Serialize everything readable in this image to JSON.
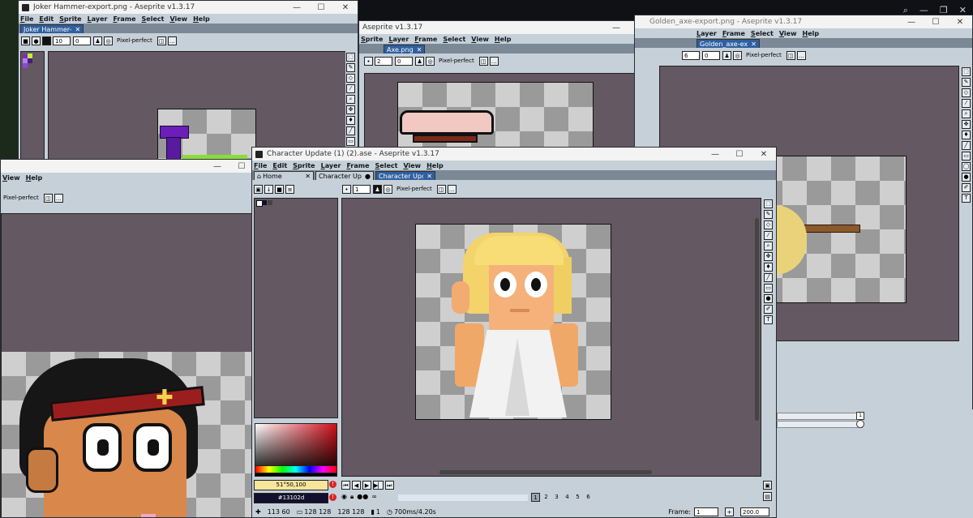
{
  "os": {
    "search_icon": "search-icon",
    "minimize": "—",
    "maximize": "❐",
    "close": "✕"
  },
  "win_joker": {
    "title": "Joker Hammer-export.png - Aseprite v1.3.17",
    "menu": [
      "File",
      "Edit",
      "Sprite",
      "Layer",
      "Frame",
      "Select",
      "View",
      "Help"
    ],
    "tab": "Joker Hammer-",
    "size_field": "10",
    "opacity_field": "0",
    "pixel_perfect": "Pixel-perfect"
  },
  "win_axe": {
    "title": "Aseprite v1.3.17",
    "menu": [
      "Sprite",
      "Layer",
      "Frame",
      "Select",
      "View",
      "Help"
    ],
    "tab": "Axe.png",
    "size_field": "2",
    "opacity_field": "0",
    "pixel_perfect": "Pixel-perfect"
  },
  "win_golden": {
    "title": "Golden_axe-export.png - Aseprite v1.3.17",
    "menu": [
      "Layer",
      "Frame",
      "Select",
      "View",
      "Help"
    ],
    "tab": "Golden_axe-ex",
    "size_field": "6",
    "opacity_field": "0",
    "pixel_perfect": "Pixel-perfect"
  },
  "win_left": {
    "menu": [
      "View",
      "Help"
    ],
    "pixel_perfect": "Pixel-perfect"
  },
  "win_main": {
    "title": "Character Update (1) (2).ase - Aseprite v1.3.17",
    "menu": [
      "File",
      "Edit",
      "Sprite",
      "Layer",
      "Frame",
      "Select",
      "View",
      "Help"
    ],
    "tabs": [
      {
        "label": "Home",
        "close": "✕",
        "active": false
      },
      {
        "label": "Character Upd",
        "close": "●",
        "active": false
      },
      {
        "label": "Character Upd",
        "close": "✕",
        "active": true
      }
    ],
    "size_field": "1",
    "pixel_perfect": "Pixel-perfect",
    "fg_color_label": "51°50,100",
    "bg_color_label": "#13102d",
    "frames": [
      "1",
      "2",
      "3",
      "4",
      "5",
      "6"
    ],
    "frame_label": "Frame:",
    "frame_value": "1",
    "zoom_value": "200.0",
    "status": {
      "coords": "113 60",
      "size1": "128 128",
      "size2": "128 128",
      "frame_info": "1",
      "duration": "700ms/4.20s"
    }
  },
  "colors": {
    "accent": "#2f5f9e",
    "canvas_bg": "#645862",
    "ui": "#c6d0d9"
  }
}
